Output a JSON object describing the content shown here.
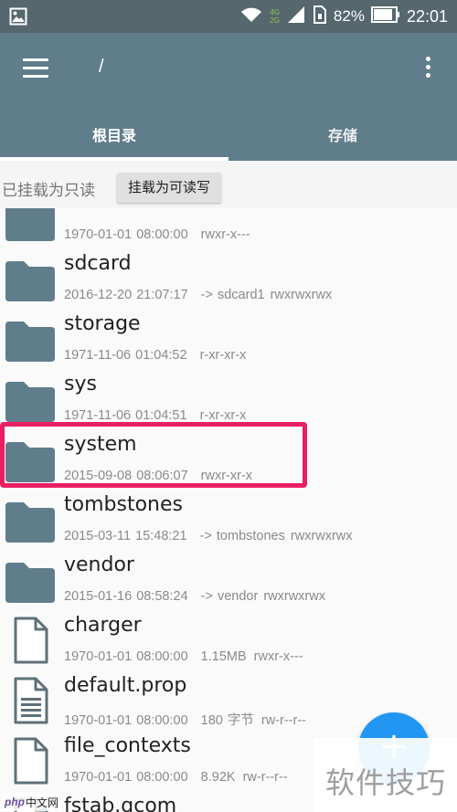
{
  "status_bar": {
    "network_label": "4G 2G",
    "battery_percent": "82%",
    "time": "22:01"
  },
  "toolbar": {
    "path": "/"
  },
  "tabs": [
    {
      "label": "根目录",
      "active": true
    },
    {
      "label": "存储",
      "active": false
    }
  ],
  "mount": {
    "status": "已挂载为只读",
    "button_label": "挂载为可读写"
  },
  "files": [
    {
      "name": "",
      "type": "folder",
      "date": "1970-01-01 08:00:00",
      "link": "",
      "size": "",
      "perms": "rwxr-x---"
    },
    {
      "name": "sdcard",
      "type": "folder",
      "date": "2016-12-20 21:07:17",
      "link": "-> sdcard1",
      "size": "",
      "perms": "rwxrwxrwx"
    },
    {
      "name": "storage",
      "type": "folder",
      "date": "1971-11-06 01:04:52",
      "link": "",
      "size": "",
      "perms": "r-xr-xr-x"
    },
    {
      "name": "sys",
      "type": "folder",
      "date": "1971-11-06 01:04:51",
      "link": "",
      "size": "",
      "perms": "r-xr-xr-x"
    },
    {
      "name": "system",
      "type": "folder",
      "date": "2015-09-08 08:06:07",
      "link": "",
      "size": "",
      "perms": "rwxr-xr-x"
    },
    {
      "name": "tombstones",
      "type": "folder",
      "date": "2015-03-11 15:48:21",
      "link": "-> tombstones",
      "size": "",
      "perms": "rwxrwxrwx"
    },
    {
      "name": "vendor",
      "type": "folder",
      "date": "2015-01-16 08:58:24",
      "link": "-> vendor",
      "size": "",
      "perms": "rwxrwxrwx"
    },
    {
      "name": "charger",
      "type": "file",
      "date": "1970-01-01 08:00:00",
      "link": "",
      "size": "1.15MB",
      "perms": "rwxr-x---"
    },
    {
      "name": "default.prop",
      "type": "text-file",
      "date": "1970-01-01 08:00:00",
      "link": "",
      "size": "180 字节",
      "perms": "rw-r--r--"
    },
    {
      "name": "file_contexts",
      "type": "file",
      "date": "1970-01-01 08:00:00",
      "link": "",
      "size": "8.92K",
      "perms": "rw-r--r--"
    },
    {
      "name": "fstab.qcom",
      "type": "file",
      "date": "",
      "link": "",
      "size": "",
      "perms": ""
    }
  ],
  "fab": {
    "label": "+"
  },
  "watermark": {
    "text": "软件技巧"
  },
  "logo": {
    "php": "php",
    "cn": "中文网"
  },
  "colors": {
    "status_bar": "#56676e",
    "toolbar": "#607d8b",
    "folder_icon": "#607d8b",
    "highlight": "#e91e63",
    "fab": "#2196f3"
  }
}
